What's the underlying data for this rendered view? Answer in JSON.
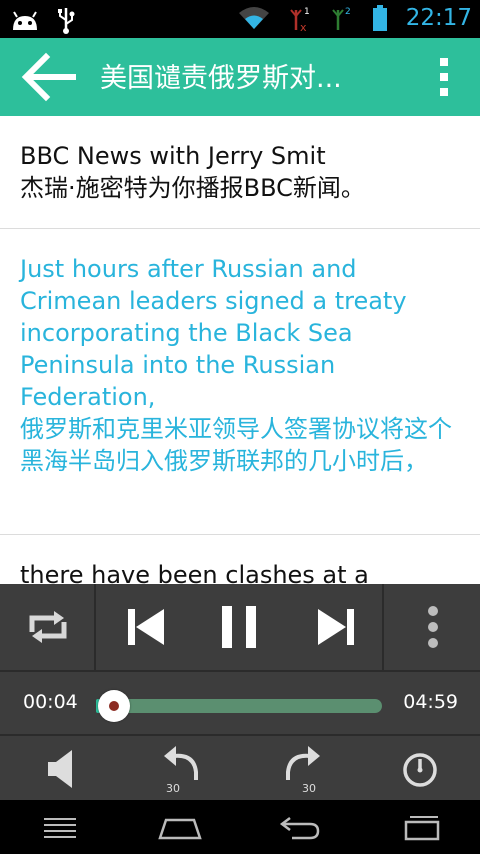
{
  "status_bar": {
    "time": "22:17",
    "icons": [
      "android-icon",
      "usb-icon",
      "wifi-icon",
      "signal-no-service-icon",
      "signal-icon",
      "battery-icon"
    ]
  },
  "action_bar": {
    "title": "美国谴责俄罗斯对...",
    "back_icon": "arrow-left-icon",
    "menu_icon": "overflow-menu-icon"
  },
  "transcript": {
    "items": [
      {
        "english": "BBC News with Jerry Smit",
        "chinese": "杰瑞·施密特为你播报BBC新闻。",
        "active": false
      },
      {
        "english": "Just hours after Russian and Crimean leaders signed a treaty incorporating the Black Sea Peninsula into the Russian Federation,",
        "chinese": "俄罗斯和克里米亚领导人签署协议将这个黑海半岛归入俄罗斯联邦的几小时后，",
        "active": true
      },
      {
        "english": "there have been clashes at a",
        "chinese": "",
        "active": false
      }
    ]
  },
  "player": {
    "current_time": "00:04",
    "total_time": "04:59",
    "progress": 0.013,
    "rewind_seconds": "30",
    "forward_seconds": "30"
  },
  "colors": {
    "accent": "#2dbf9b",
    "active_text": "#29b4dc",
    "player_bg": "#3d3d3d"
  }
}
